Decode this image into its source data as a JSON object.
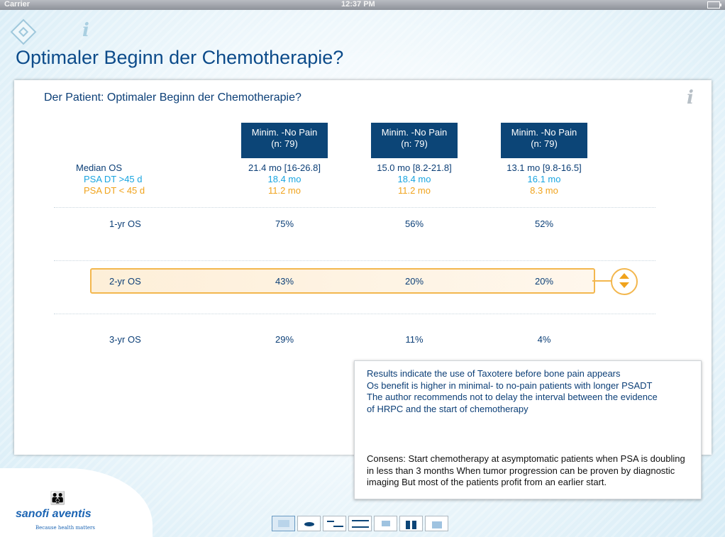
{
  "status_bar": {
    "carrier": "Carrier",
    "time": "12:37 PM"
  },
  "page_title": "Optimaler Beginn der Chemotherapie?",
  "card": {
    "title": "Der Patient: Optimaler Beginn der Chemotherapie?",
    "columns": [
      {
        "line1": "Minim. -No Pain",
        "line2": "(n: 79)"
      },
      {
        "line1": "Minim. -No Pain",
        "line2": "(n: 79)"
      },
      {
        "line1": "Minim. -No Pain",
        "line2": "(n: 79)"
      }
    ],
    "median": {
      "label": "Median OS",
      "psa_gt_label": "PSA DT >45 d",
      "psa_lt_label": "PSA DT < 45 d",
      "values": [
        {
          "median": "21.4 mo [16-26.8]",
          "gt": "18.4 mo",
          "lt": "11.2 mo"
        },
        {
          "median": "15.0 mo [8.2-21.8]",
          "gt": "18.4 mo",
          "lt": "11.2 mo"
        },
        {
          "median": "13.1 mo [9.8-16.5]",
          "gt": "16.1 mo",
          "lt": "8.3 mo"
        }
      ]
    },
    "rows": [
      {
        "label": "1-yr OS",
        "values": [
          "75%",
          "56%",
          "52%"
        ]
      },
      {
        "label": "2-yr OS",
        "values": [
          "43%",
          "20%",
          "20%"
        ]
      },
      {
        "label": "3-yr OS",
        "values": [
          "29%",
          "11%",
          "4%"
        ]
      }
    ]
  },
  "popup": {
    "lines": [
      "Results indicate the use of Taxotere before bone pain appears",
      "Os benefit is higher in minimal- to no-pain patients with longer PSADT",
      "The author recommends not to delay the interval between the evidence",
      "of HRPC and the start of chemotherapy"
    ],
    "consens": "Consens: Start chemotherapy at asymptomatic patients when PSA is doubling in less than 3 months When tumor progression can be proven by diagnostic imaging But most of the patients profit from an earlier start."
  },
  "logo": {
    "name": "sanofi aventis",
    "tagline": "Because health matters"
  },
  "icons": {
    "home": "diamond-home-icon",
    "info": "info-icon",
    "stepper": "up-down-arrows-icon"
  },
  "colors": {
    "navy": "#0c4577",
    "blue_text": "#1aa5e0",
    "orange": "#f0a31c",
    "title": "#0c4b8a"
  }
}
